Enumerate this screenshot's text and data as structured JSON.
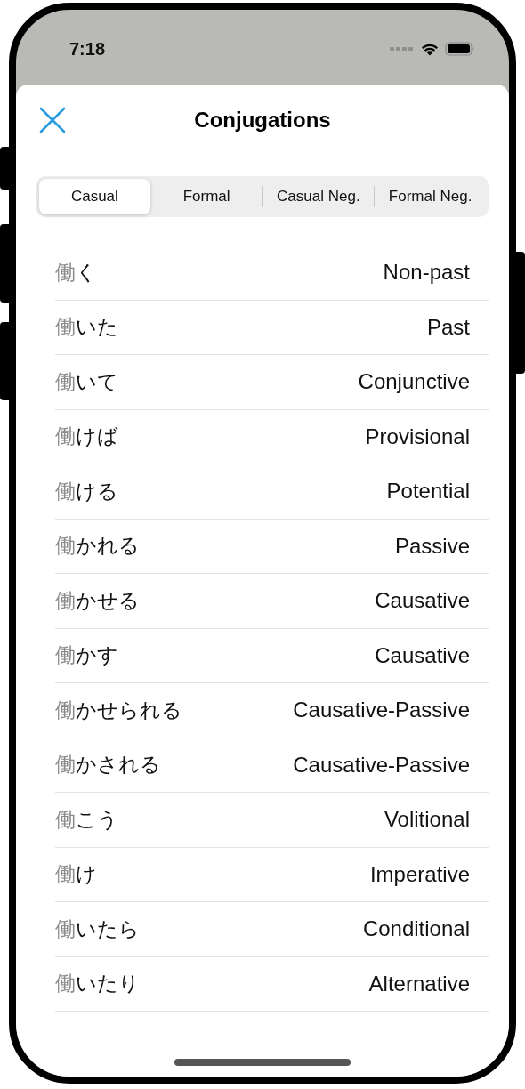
{
  "status_bar": {
    "time": "7:18"
  },
  "title": "Conjugations",
  "segments": [
    {
      "label": "Casual",
      "selected": true
    },
    {
      "label": "Formal",
      "selected": false
    },
    {
      "label": "Casual Neg.",
      "selected": false
    },
    {
      "label": "Formal Neg.",
      "selected": false
    }
  ],
  "rows": [
    {
      "stem": "働",
      "ending": "く",
      "form": "Non-past"
    },
    {
      "stem": "働",
      "ending": "いた",
      "form": "Past"
    },
    {
      "stem": "働",
      "ending": "いて",
      "form": "Conjunctive"
    },
    {
      "stem": "働",
      "ending": "けば",
      "form": "Provisional"
    },
    {
      "stem": "働",
      "ending": "ける",
      "form": "Potential"
    },
    {
      "stem": "働",
      "ending": "かれる",
      "form": "Passive"
    },
    {
      "stem": "働",
      "ending": "かせる",
      "form": "Causative"
    },
    {
      "stem": "働",
      "ending": "かす",
      "form": "Causative"
    },
    {
      "stem": "働",
      "ending": "かせられる",
      "form": "Causative-Passive"
    },
    {
      "stem": "働",
      "ending": "かされる",
      "form": "Causative-Passive"
    },
    {
      "stem": "働",
      "ending": "こう",
      "form": "Volitional"
    },
    {
      "stem": "働",
      "ending": "け",
      "form": "Imperative"
    },
    {
      "stem": "働",
      "ending": "いたら",
      "form": "Conditional"
    },
    {
      "stem": "働",
      "ending": "いたり",
      "form": "Alternative"
    }
  ]
}
